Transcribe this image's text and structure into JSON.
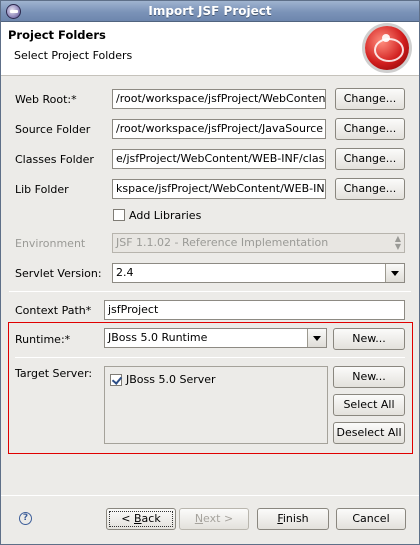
{
  "window": {
    "title": "Import JSF Project"
  },
  "header": {
    "title": "Project Folders",
    "subtitle": "Select Project Folders"
  },
  "fields": {
    "web_root": {
      "label": "Web Root:*",
      "value": "/root/workspace/jsfProject/WebContent",
      "button": "Change..."
    },
    "source_folder": {
      "label": "Source Folder",
      "value": "/root/workspace/jsfProject/JavaSource",
      "button": "Change..."
    },
    "classes_folder": {
      "label": "Classes Folder",
      "value": "e/jsfProject/WebContent/WEB-INF/classes",
      "button": "Change..."
    },
    "lib_folder": {
      "label": "Lib Folder",
      "value": "kspace/jsfProject/WebContent/WEB-INF/lib",
      "button": "Change..."
    }
  },
  "add_libraries": {
    "label": "Add Libraries",
    "checked": false
  },
  "environment": {
    "label": "Environment",
    "value": "JSF 1.1.02 - Reference Implementation"
  },
  "servlet_version": {
    "label": "Servlet Version:",
    "value": "2.4"
  },
  "context_path": {
    "label": "Context Path*",
    "value": "jsfProject"
  },
  "runtime": {
    "label": "Runtime:*",
    "value": "JBoss 5.0 Runtime",
    "button": "New..."
  },
  "target_server": {
    "label": "Target Server:",
    "items": [
      {
        "label": "JBoss 5.0 Server",
        "checked": true
      }
    ],
    "buttons": {
      "new": "New...",
      "select_all": "Select All",
      "deselect_all": "Deselect All"
    }
  },
  "footer": {
    "help": "?",
    "back_mnemonic": "B",
    "back_rest": "ack",
    "back_prefix": "< ",
    "next_mnemonic": "N",
    "next_rest": "ext >",
    "finish_mnemonic": "F",
    "finish_rest": "inish",
    "cancel": "Cancel"
  },
  "colors": {
    "highlight_border": "#e00000",
    "titlebar": "#7b93b8"
  }
}
